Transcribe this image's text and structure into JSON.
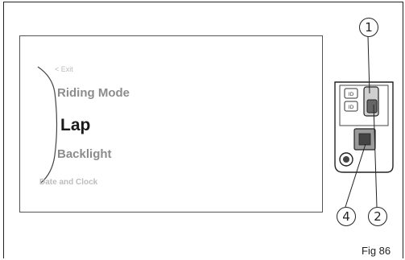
{
  "menu": {
    "exit": "< Exit",
    "items": [
      "Riding Mode",
      "Lap",
      "Backlight"
    ],
    "date_clock": "Date and Clock"
  },
  "switch_labels": {
    "upper": "ID",
    "lower": "ID"
  },
  "callouts": [
    "1",
    "2",
    "4"
  ],
  "figure_label": "Fig 86",
  "colors": {
    "selected": "#1a1a1a",
    "unselected": "#8c8c8c",
    "faded": "#bdbdbd"
  }
}
